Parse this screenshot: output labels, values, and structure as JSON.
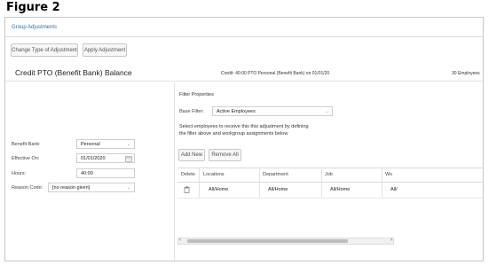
{
  "figure_title": "Figure 2",
  "window": {
    "title": "Group Adjustments"
  },
  "toolbar": {
    "change_type_label": "Change Type of Adjustment",
    "apply_label": "Apply Adjustment"
  },
  "header": {
    "title": "Credit PTO (Benefit Bank) Balance",
    "summary": "Credit: 40:00 PTO Personal (Benefit Bank) on 01/01/20",
    "employee_count": "30 Employees"
  },
  "form": {
    "benefit_bank": {
      "label": "Benefit Bank:",
      "value": "Personal"
    },
    "effective_on": {
      "label": "Effective On:",
      "value": "01/01/2020"
    },
    "hours": {
      "label": "Hours:",
      "value": "40:00"
    },
    "reason_code": {
      "label": "Reason Code:",
      "value": "[no reason given]"
    }
  },
  "filter": {
    "heading": "Filter Properties",
    "base_filter_label": "Base Filter:",
    "base_filter_value": "Active Employees",
    "help_line1": "Select employees to receive this this adjustment by defining",
    "help_line2": "the filter above and workgroup assignments below",
    "add_new_label": "Add New",
    "remove_all_label": "Remove All"
  },
  "table": {
    "columns": [
      "Delete",
      "Locations",
      "Department",
      "Job",
      "Wo"
    ],
    "rows": [
      {
        "delete_icon": "trash-icon",
        "locations": "All/Home",
        "department": "All/Home",
        "job": "All/Home",
        "wo": "All/"
      }
    ]
  },
  "icons": {
    "calendar": "calendar-icon",
    "dropdown": "chevron-down-icon",
    "delete": "trash-icon",
    "scroll_left": "scroll-left-arrow-icon",
    "scroll_right": "scroll-right-arrow-icon"
  },
  "colors": {
    "link_blue": "#2a6fb3",
    "border": "#c8c8c8"
  }
}
